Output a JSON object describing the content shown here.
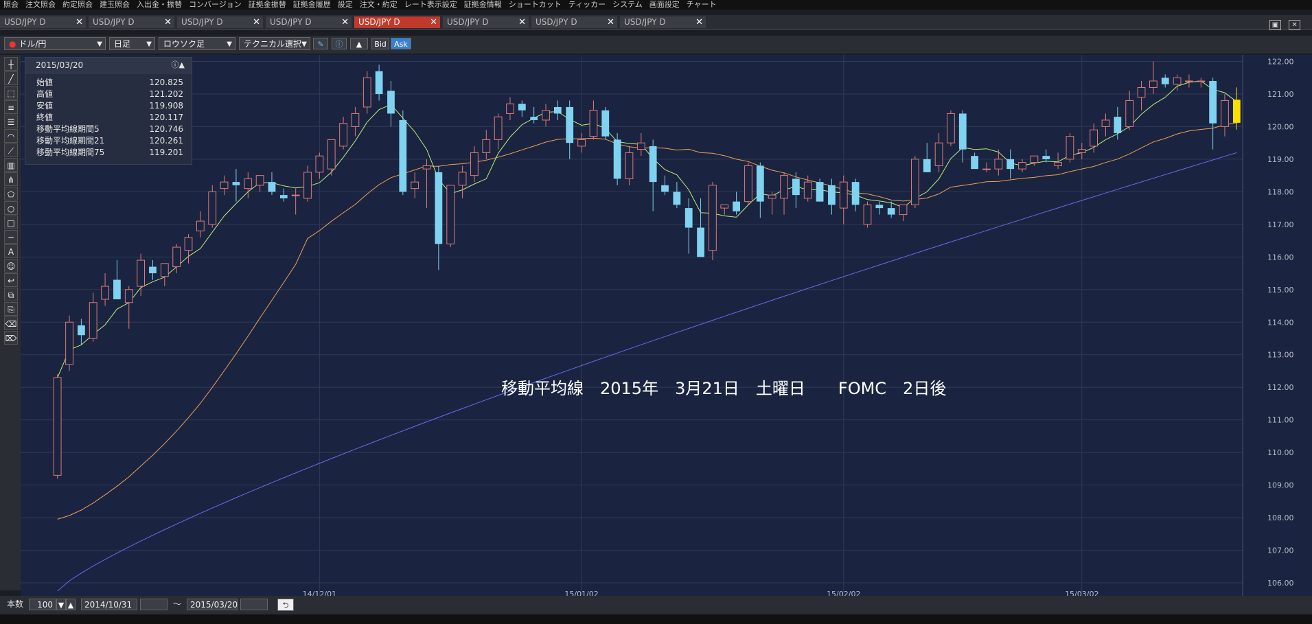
{
  "menu": [
    "照会",
    "注文照会",
    "約定照会",
    "建玉照会",
    "入出金・振替",
    "コンバージョン",
    "証拠金振替",
    "証拠金履歴",
    "設定",
    "注文・約定",
    "レート表示設定",
    "証拠金情報",
    "ショートカット",
    "ティッカー",
    "システム",
    "画面設定",
    "チャート"
  ],
  "tabs": [
    {
      "label": "USD/JPY D",
      "active": false
    },
    {
      "label": "USD/JPY D",
      "active": false
    },
    {
      "label": "USD/JPY D",
      "active": false
    },
    {
      "label": "USD/JPY D",
      "active": false
    },
    {
      "label": "USD/JPY D",
      "active": true
    },
    {
      "label": "USD/JPY D",
      "active": false
    },
    {
      "label": "USD/JPY D",
      "active": false
    },
    {
      "label": "USD/JPY D",
      "active": false
    }
  ],
  "toolbar": {
    "pair": "ドル/円",
    "timeframe": "日足",
    "chart_style": "ロウソク足",
    "technical": "テクニカル選択",
    "bid": "Bid",
    "ask": "Ask"
  },
  "info": {
    "date": "2015/03/20",
    "rows": [
      {
        "label": "始値",
        "value": "120.825"
      },
      {
        "label": "高値",
        "value": "121.202"
      },
      {
        "label": "安値",
        "value": "119.908"
      },
      {
        "label": "終値",
        "value": "120.117"
      },
      {
        "label": "移動平均線期間5",
        "value": "120.746"
      },
      {
        "label": "移動平均線期間21",
        "value": "120.261"
      },
      {
        "label": "移動平均線期間75",
        "value": "119.201"
      }
    ]
  },
  "bottom": {
    "count_label": "本数",
    "count": "100",
    "from": "2014/10/31",
    "sep": "～",
    "to": "2015/03/20"
  },
  "colors": {
    "up": "#e07a7a",
    "down": "#7fd3f0",
    "ma5": "#b8f07a",
    "ma21": "#f0a050",
    "ma75": "#6a6af0",
    "last": "#ffe000"
  },
  "chart_data": {
    "type": "candlestick",
    "annotation": "移動平均線　2015年　3月21日　土曜日　　FOMC　2日後",
    "ylim": [
      105.6,
      122.2
    ],
    "yticks": [
      "106.00",
      "107.00",
      "108.00",
      "109.00",
      "110.00",
      "111.00",
      "112.00",
      "113.00",
      "114.00",
      "115.00",
      "116.00",
      "117.00",
      "118.00",
      "119.00",
      "120.00",
      "121.00",
      "122.00"
    ],
    "xticks": [
      {
        "label": "14/12/01",
        "i": 22
      },
      {
        "label": "15/01/02",
        "i": 44
      },
      {
        "label": "15/02/02",
        "i": 66
      },
      {
        "label": "15/03/02",
        "i": 86
      }
    ],
    "ohlc": [
      [
        109.3,
        112.4,
        109.2,
        112.3
      ],
      [
        112.7,
        114.2,
        112.5,
        114.0
      ],
      [
        113.9,
        114.1,
        113.3,
        113.6
      ],
      [
        113.5,
        114.9,
        113.4,
        114.6
      ],
      [
        114.7,
        115.5,
        114.5,
        115.1
      ],
      [
        115.3,
        115.9,
        114.9,
        114.7
      ],
      [
        114.6,
        115.1,
        113.8,
        115.0
      ],
      [
        115.1,
        116.1,
        114.8,
        115.9
      ],
      [
        115.7,
        115.9,
        115.3,
        115.5
      ],
      [
        115.4,
        115.8,
        115.1,
        115.8
      ],
      [
        115.7,
        116.4,
        115.5,
        116.3
      ],
      [
        116.2,
        116.7,
        115.8,
        116.6
      ],
      [
        116.8,
        117.4,
        116.6,
        117.1
      ],
      [
        117.0,
        118.2,
        116.9,
        118.0
      ],
      [
        118.1,
        118.5,
        117.9,
        118.3
      ],
      [
        118.3,
        118.7,
        117.7,
        118.2
      ],
      [
        118.1,
        118.6,
        117.8,
        118.4
      ],
      [
        118.2,
        118.5,
        118.0,
        118.5
      ],
      [
        118.3,
        118.6,
        117.9,
        118.0
      ],
      [
        117.9,
        118.1,
        117.7,
        117.8
      ],
      [
        117.9,
        118.1,
        117.3,
        117.9
      ],
      [
        117.8,
        118.8,
        117.7,
        118.6
      ],
      [
        118.6,
        119.2,
        118.4,
        119.1
      ],
      [
        118.7,
        119.5,
        118.5,
        119.6
      ],
      [
        119.4,
        120.3,
        119.3,
        120.1
      ],
      [
        120.0,
        120.6,
        119.7,
        120.4
      ],
      [
        120.6,
        121.7,
        120.4,
        121.5
      ],
      [
        121.7,
        121.9,
        120.8,
        121.0
      ],
      [
        121.1,
        121.4,
        120.0,
        120.4
      ],
      [
        120.2,
        120.5,
        117.9,
        118.0
      ],
      [
        118.1,
        118.6,
        117.8,
        118.3
      ],
      [
        118.7,
        119.0,
        117.5,
        118.8
      ],
      [
        118.6,
        118.8,
        115.6,
        116.4
      ],
      [
        116.4,
        118.2,
        116.3,
        118.2
      ],
      [
        118.2,
        118.8,
        117.8,
        118.6
      ],
      [
        118.5,
        119.4,
        118.3,
        119.2
      ],
      [
        119.2,
        119.9,
        119.0,
        119.6
      ],
      [
        119.6,
        120.4,
        119.3,
        120.3
      ],
      [
        120.4,
        120.9,
        120.2,
        120.7
      ],
      [
        120.7,
        120.8,
        120.3,
        120.5
      ],
      [
        120.3,
        120.6,
        120.1,
        120.2
      ],
      [
        120.2,
        120.7,
        120.0,
        120.5
      ],
      [
        120.6,
        120.8,
        120.2,
        120.4
      ],
      [
        120.6,
        120.8,
        119.0,
        119.5
      ],
      [
        119.4,
        119.8,
        119.2,
        119.6
      ],
      [
        119.7,
        120.8,
        119.6,
        120.5
      ],
      [
        120.5,
        120.6,
        119.6,
        119.7
      ],
      [
        119.6,
        119.8,
        118.2,
        118.4
      ],
      [
        118.4,
        119.4,
        118.2,
        119.2
      ],
      [
        119.3,
        119.8,
        119.1,
        119.5
      ],
      [
        119.4,
        119.6,
        117.4,
        118.3
      ],
      [
        118.2,
        118.5,
        117.9,
        118.0
      ],
      [
        118.0,
        118.3,
        117.5,
        117.6
      ],
      [
        117.5,
        117.8,
        116.1,
        116.9
      ],
      [
        116.9,
        117.8,
        116.0,
        116.0
      ],
      [
        116.2,
        118.3,
        115.9,
        118.2
      ],
      [
        117.5,
        117.6,
        117.3,
        117.6
      ],
      [
        117.7,
        118.0,
        117.3,
        117.4
      ],
      [
        117.7,
        118.9,
        117.6,
        118.8
      ],
      [
        118.8,
        118.9,
        117.2,
        117.7
      ],
      [
        117.8,
        118.0,
        117.3,
        117.9
      ],
      [
        117.8,
        118.6,
        117.3,
        118.5
      ],
      [
        118.4,
        118.6,
        117.5,
        117.9
      ],
      [
        117.8,
        118.5,
        117.7,
        118.3
      ],
      [
        118.3,
        118.4,
        117.7,
        117.7
      ],
      [
        118.2,
        118.4,
        117.3,
        117.6
      ],
      [
        117.5,
        118.5,
        117.0,
        118.3
      ],
      [
        118.3,
        118.4,
        117.4,
        117.6
      ],
      [
        117.0,
        117.7,
        116.9,
        117.6
      ],
      [
        117.6,
        117.7,
        117.3,
        117.5
      ],
      [
        117.5,
        117.7,
        117.2,
        117.3
      ],
      [
        117.3,
        117.6,
        117.1,
        117.6
      ],
      [
        117.6,
        119.1,
        117.5,
        119.0
      ],
      [
        119.0,
        119.5,
        118.6,
        118.6
      ],
      [
        118.8,
        119.8,
        118.6,
        119.5
      ],
      [
        119.5,
        120.5,
        119.4,
        120.4
      ],
      [
        120.4,
        120.5,
        118.9,
        119.3
      ],
      [
        119.1,
        119.2,
        118.7,
        118.7
      ],
      [
        118.7,
        118.9,
        118.6,
        118.7
      ],
      [
        118.7,
        119.3,
        118.5,
        119.0
      ],
      [
        119.0,
        119.3,
        118.4,
        118.7
      ],
      [
        118.7,
        119.0,
        118.6,
        118.9
      ],
      [
        118.9,
        119.1,
        118.8,
        119.1
      ],
      [
        119.1,
        119.3,
        118.9,
        119.0
      ],
      [
        118.8,
        119.2,
        118.7,
        118.9
      ],
      [
        119.0,
        119.8,
        118.9,
        119.7
      ],
      [
        119.2,
        119.5,
        119.0,
        119.3
      ],
      [
        119.4,
        120.1,
        119.2,
        119.9
      ],
      [
        120.0,
        120.4,
        119.7,
        120.2
      ],
      [
        120.3,
        120.6,
        119.6,
        119.8
      ],
      [
        120.0,
        121.1,
        119.9,
        120.8
      ],
      [
        120.9,
        121.4,
        120.5,
        121.2
      ],
      [
        121.2,
        122.0,
        121.0,
        121.4
      ],
      [
        121.5,
        121.6,
        121.2,
        121.3
      ],
      [
        121.3,
        121.6,
        121.1,
        121.5
      ],
      [
        121.4,
        121.6,
        121.2,
        121.4
      ],
      [
        121.4,
        121.5,
        121.2,
        121.4
      ],
      [
        121.4,
        121.5,
        119.3,
        120.1
      ],
      [
        120.0,
        121.0,
        119.7,
        120.8
      ],
      [
        120.825,
        121.202,
        119.908,
        120.117
      ]
    ]
  }
}
